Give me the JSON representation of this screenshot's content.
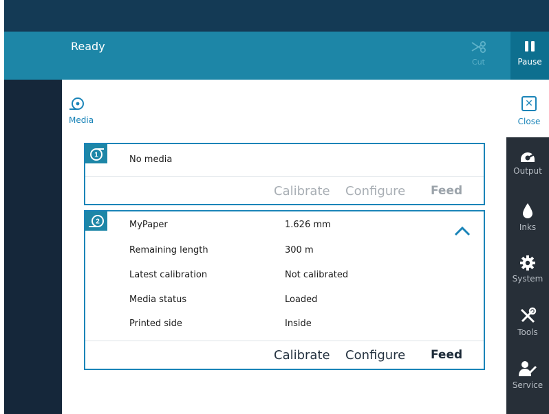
{
  "header": {
    "status": "Ready",
    "cut_label": "Cut",
    "pause_label": "Pause"
  },
  "media_panel": {
    "title": "Media",
    "close_label": "Close"
  },
  "trays": [
    {
      "number": "1",
      "status": "No media",
      "actions": {
        "calibrate": "Calibrate",
        "configure": "Configure",
        "feed": "Feed"
      },
      "actions_enabled": false
    },
    {
      "number": "2",
      "name": "MyPaper",
      "thickness": "1.626 mm",
      "details": [
        {
          "label": "Remaining length",
          "value": "300 m"
        },
        {
          "label": "Latest calibration",
          "value": "Not calibrated"
        },
        {
          "label": "Media status",
          "value": "Loaded"
        },
        {
          "label": "Printed side",
          "value": "Inside"
        }
      ],
      "actions": {
        "calibrate": "Calibrate",
        "configure": "Configure",
        "feed": "Feed"
      },
      "actions_enabled": true,
      "expanded": true
    }
  ],
  "nav": [
    {
      "label": "Output",
      "icon": "output-icon"
    },
    {
      "label": "Inks",
      "icon": "ink-drop-icon"
    },
    {
      "label": "System",
      "icon": "gear-icon"
    },
    {
      "label": "Tools",
      "icon": "tools-icon"
    },
    {
      "label": "Service",
      "icon": "service-icon"
    }
  ],
  "colors": {
    "accent": "#1a84b8",
    "status_bar": "#1d86a7",
    "top_bar": "#143a55",
    "nav_bg": "#272f38"
  }
}
